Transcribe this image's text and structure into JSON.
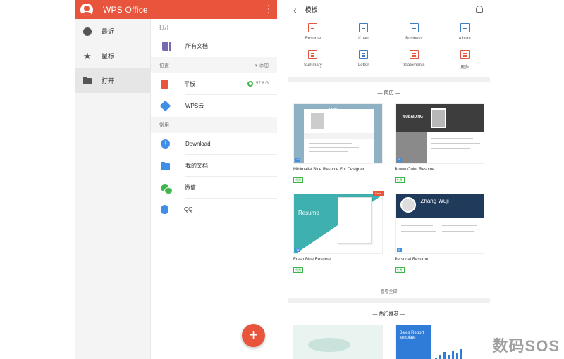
{
  "left": {
    "app_title": "WPS Office",
    "nav": [
      {
        "label": "最近",
        "icon": "clock-icon"
      },
      {
        "label": "星标",
        "icon": "star-icon"
      },
      {
        "label": "打开",
        "icon": "folder-icon",
        "active": true
      }
    ],
    "open_label": "打开",
    "all_docs": "所有文档",
    "location_label": "位置",
    "add_label": "▾ 添加",
    "tablet": "平板",
    "storage": "57.8 G",
    "wps_cloud": "WPS云",
    "common_label": "常用",
    "common": [
      "Download",
      "我的文档",
      "微信",
      "QQ"
    ],
    "fab": "+"
  },
  "right": {
    "title": "模板",
    "back_icon": "back-arrow-icon",
    "categories": [
      "Resume",
      "Chart",
      "Business",
      "Album",
      "Summary",
      "Letter",
      "Statements",
      "更多"
    ],
    "resume_section": "— 简历 —",
    "templates": [
      {
        "name": "Minimalist Blue Resume For Designer",
        "badge": "免费",
        "thumb_text": "WEI"
      },
      {
        "name": "Brown Color Resume",
        "badge": "免费",
        "thumb_text": "WUBAIDING"
      },
      {
        "name": "Fresh Blue Resume",
        "badge": "免费",
        "thumb_text": "Resume",
        "tag": "Free"
      },
      {
        "name": "Personal Resume",
        "badge": "免费",
        "thumb_text": "Zhang Wuji"
      }
    ],
    "see_all": "查看全部",
    "hot_section": "— 热门推荐 —",
    "hot_report": "Sales Report template"
  },
  "watermark": "数码SOS",
  "colors": {
    "brand": "#e8543c",
    "blue": "#3f8ee8",
    "green": "#3fb64a"
  }
}
